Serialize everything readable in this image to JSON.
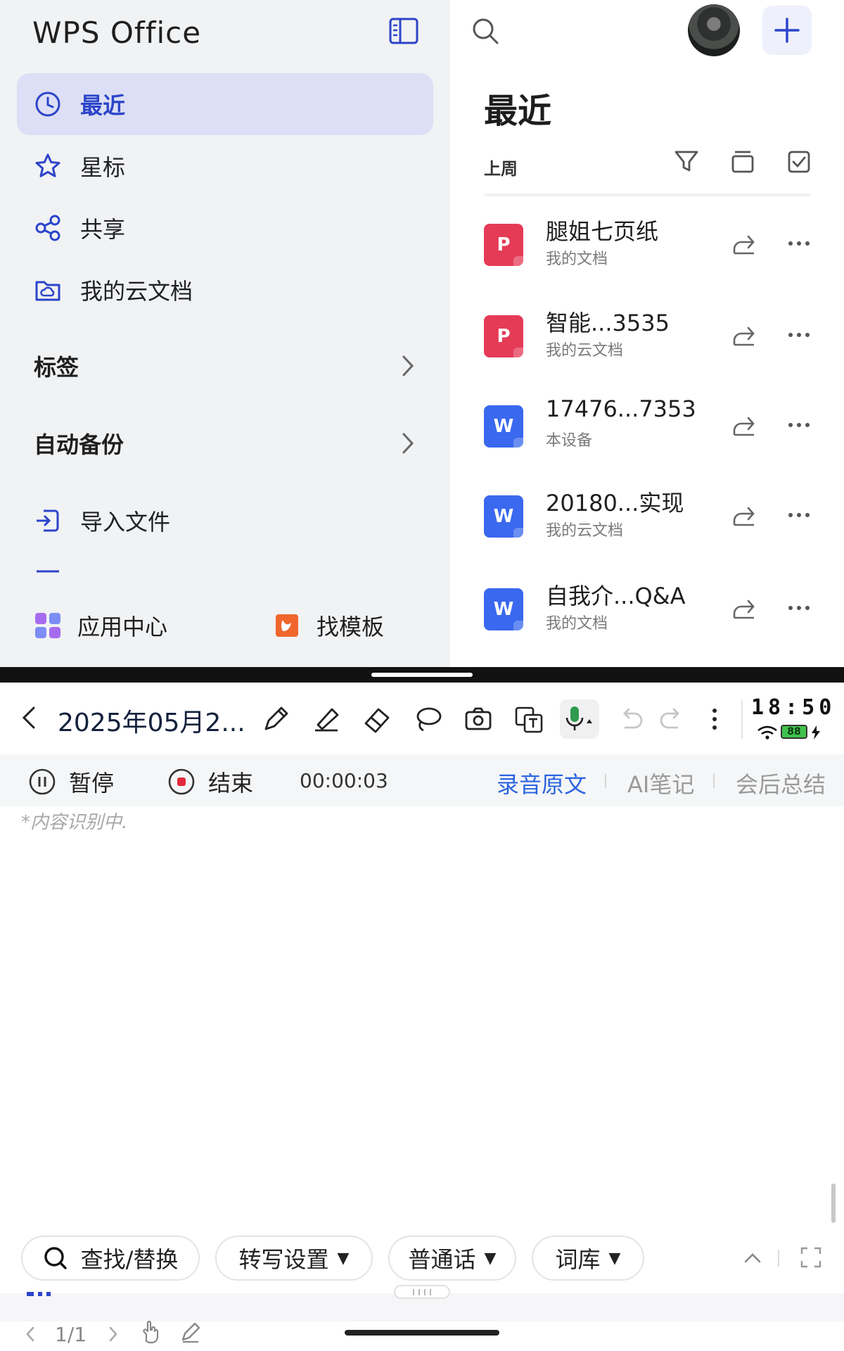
{
  "app": {
    "logo": "WPS Office",
    "accent_color": "#2c44c9"
  },
  "sidebar": {
    "nav": [
      {
        "label": "最近",
        "icon": "clock-icon",
        "active": true
      },
      {
        "label": "星标",
        "icon": "star-icon",
        "active": false
      },
      {
        "label": "共享",
        "icon": "share-nodes-icon",
        "active": false
      },
      {
        "label": "我的云文档",
        "icon": "cloud-folder-icon",
        "active": false
      }
    ],
    "sections": [
      {
        "label": "标签"
      },
      {
        "label": "自动备份"
      }
    ],
    "import_label": "导入文件",
    "bottom": {
      "app_center": "应用中心",
      "templates": "找模板"
    }
  },
  "main": {
    "title": "最近",
    "period": "上周",
    "files": [
      {
        "name": "腿姐七页纸",
        "location": "我的文档",
        "type": "ppt",
        "badge": "P"
      },
      {
        "name": "智能...3535",
        "location": "我的云文档",
        "type": "ppt",
        "badge": "P"
      },
      {
        "name": "17476...7353",
        "location": "本设备",
        "type": "doc",
        "badge": "W"
      },
      {
        "name": "20180...实现",
        "location": "我的云文档",
        "type": "doc",
        "badge": "W"
      },
      {
        "name": "自我介...Q&A",
        "location": "我的文档",
        "type": "doc",
        "badge": "W"
      }
    ]
  },
  "note": {
    "title": "2025年05月2...",
    "clock": "18:50",
    "battery": "88",
    "recording": {
      "pause_label": "暂停",
      "stop_label": "结束",
      "timer": "00:00:03"
    },
    "tabs": [
      {
        "label": "录音原文",
        "active": true
      },
      {
        "label": "AI笔记",
        "active": false
      },
      {
        "label": "会后总结",
        "active": false
      }
    ],
    "status_text": "*内容识别中.",
    "pills": {
      "find_replace": "查找/替换",
      "transcribe_settings": "转写设置",
      "language": "普通话",
      "dictionary": "词库",
      "caret": "▼"
    },
    "page": "1/1"
  }
}
